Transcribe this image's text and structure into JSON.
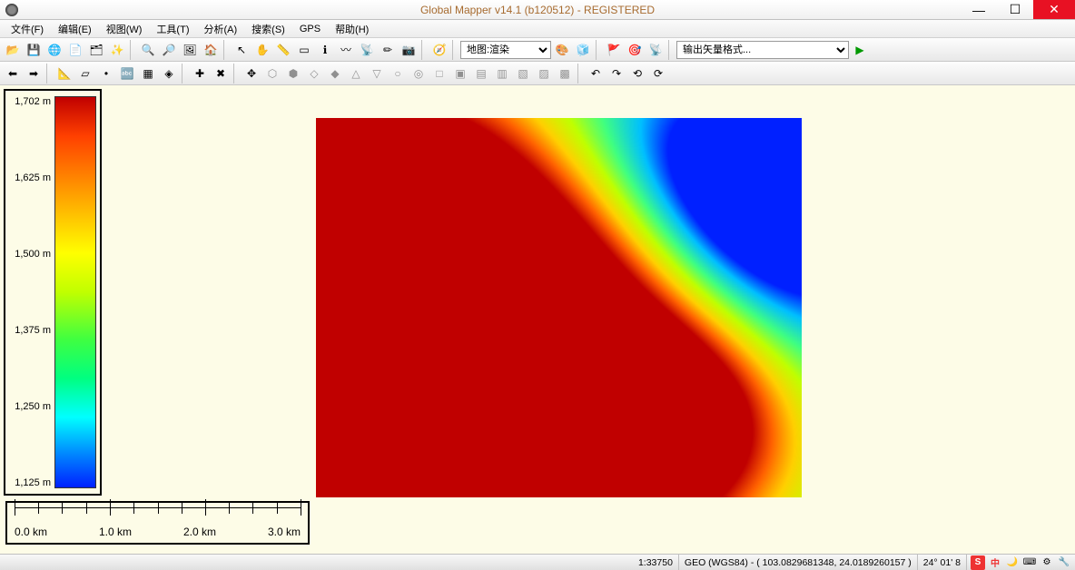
{
  "window": {
    "title": "Global Mapper v14.1 (b120512) - REGISTERED"
  },
  "menu": {
    "items": [
      "文件(F)",
      "编辑(E)",
      "视图(W)",
      "工具(T)",
      "分析(A)",
      "搜索(S)",
      "GPS",
      "帮助(H)"
    ]
  },
  "toolbar1": {
    "render_mode_selected": "地图:渲染",
    "export_format_placeholder": "输出矢量格式..."
  },
  "legend": {
    "ticks": [
      "1,702 m",
      "1,625 m",
      "1,500 m",
      "1,375 m",
      "1,250 m",
      "1,125 m"
    ]
  },
  "scalebar": {
    "labels": [
      "0.0 km",
      "1.0 km",
      "2.0 km",
      "3.0 km"
    ]
  },
  "status": {
    "scale": "1:33750",
    "proj": "GEO (WGS84) - ( 103.0829681348, 24.0189260157 )",
    "coord": "24° 01' 8",
    "ime": "中"
  },
  "chart_data": {
    "type": "heatmap",
    "title": "Elevation",
    "unit": "m",
    "color_scale": {
      "min": 1125,
      "max": 1702,
      "stops": [
        {
          "value": 1125,
          "color": "#0020ff"
        },
        {
          "value": 1200,
          "color": "#00c0ff"
        },
        {
          "value": 1300,
          "color": "#40ff80"
        },
        {
          "value": 1400,
          "color": "#c0ff00"
        },
        {
          "value": 1500,
          "color": "#ffd000"
        },
        {
          "value": 1600,
          "color": "#ff6000"
        },
        {
          "value": 1702,
          "color": "#c00000"
        }
      ]
    },
    "scale_km_per_100px": 0.9
  }
}
